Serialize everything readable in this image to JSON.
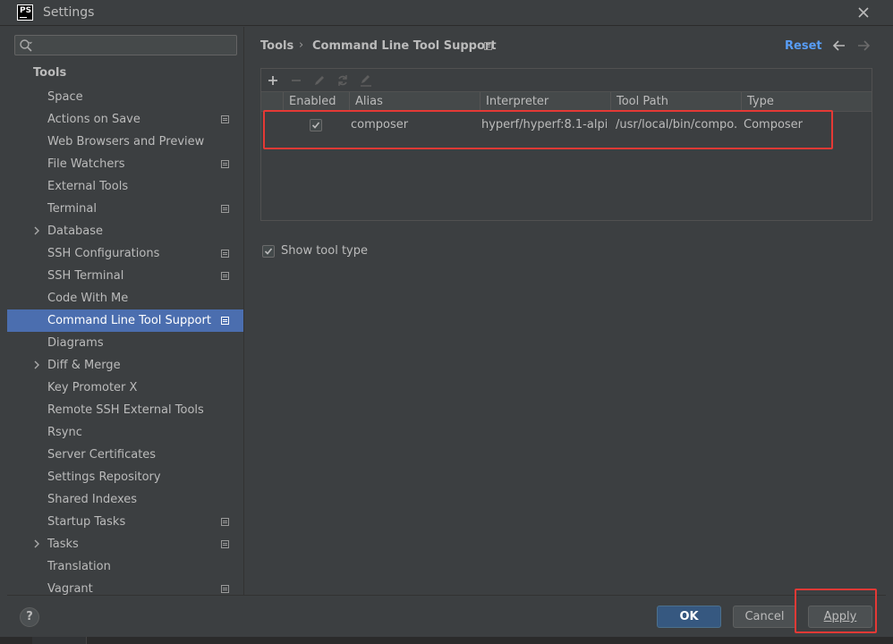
{
  "window": {
    "title": "Settings",
    "app_logo": "PS"
  },
  "sidebar": {
    "search": {
      "placeholder": "",
      "value": ""
    },
    "header": "Tools",
    "items": [
      {
        "label": "Space",
        "badge": false,
        "expandable": false,
        "selected": false
      },
      {
        "label": "Actions on Save",
        "badge": true,
        "expandable": false,
        "selected": false
      },
      {
        "label": "Web Browsers and Preview",
        "badge": false,
        "expandable": false,
        "selected": false
      },
      {
        "label": "File Watchers",
        "badge": true,
        "expandable": false,
        "selected": false
      },
      {
        "label": "External Tools",
        "badge": false,
        "expandable": false,
        "selected": false
      },
      {
        "label": "Terminal",
        "badge": true,
        "expandable": false,
        "selected": false
      },
      {
        "label": "Database",
        "badge": false,
        "expandable": true,
        "selected": false
      },
      {
        "label": "SSH Configurations",
        "badge": true,
        "expandable": false,
        "selected": false
      },
      {
        "label": "SSH Terminal",
        "badge": true,
        "expandable": false,
        "selected": false
      },
      {
        "label": "Code With Me",
        "badge": false,
        "expandable": false,
        "selected": false
      },
      {
        "label": "Command Line Tool Support",
        "badge": true,
        "expandable": false,
        "selected": true
      },
      {
        "label": "Diagrams",
        "badge": false,
        "expandable": false,
        "selected": false
      },
      {
        "label": "Diff & Merge",
        "badge": false,
        "expandable": true,
        "selected": false
      },
      {
        "label": "Key Promoter X",
        "badge": false,
        "expandable": false,
        "selected": false
      },
      {
        "label": "Remote SSH External Tools",
        "badge": false,
        "expandable": false,
        "selected": false
      },
      {
        "label": "Rsync",
        "badge": false,
        "expandable": false,
        "selected": false
      },
      {
        "label": "Server Certificates",
        "badge": false,
        "expandable": false,
        "selected": false
      },
      {
        "label": "Settings Repository",
        "badge": false,
        "expandable": false,
        "selected": false
      },
      {
        "label": "Shared Indexes",
        "badge": false,
        "expandable": false,
        "selected": false
      },
      {
        "label": "Startup Tasks",
        "badge": true,
        "expandable": false,
        "selected": false
      },
      {
        "label": "Tasks",
        "badge": true,
        "expandable": true,
        "selected": false
      },
      {
        "label": "Translation",
        "badge": false,
        "expandable": false,
        "selected": false
      },
      {
        "label": "Vagrant",
        "badge": true,
        "expandable": false,
        "selected": false
      }
    ]
  },
  "main": {
    "breadcrumb": {
      "parent": "Tools",
      "separator": "›",
      "current": "Command Line Tool Support"
    },
    "reset_label": "Reset",
    "table": {
      "columns": [
        "Enabled",
        "Alias",
        "Interpreter",
        "Tool Path",
        "Type"
      ],
      "rows": [
        {
          "enabled": true,
          "alias": "composer",
          "interpreter": "hyperf/hyperf:8.1-alpi...",
          "tool_path": "/usr/local/bin/compo...",
          "type": "Composer"
        }
      ]
    },
    "show_tool_type": {
      "label": "Show tool type",
      "checked": true
    }
  },
  "footer": {
    "help_label": "?",
    "ok_label": "OK",
    "cancel_label": "Cancel",
    "apply_label": "Apply"
  },
  "colors": {
    "background": "#3c3f41",
    "selection": "#4b6eaf",
    "link": "#589df6",
    "primary_button": "#365880",
    "highlight_annotation": "#e53935"
  }
}
